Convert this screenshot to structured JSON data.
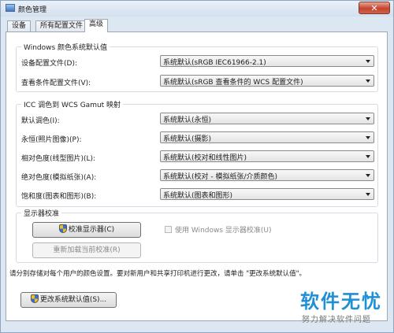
{
  "window": {
    "title": "颜色管理",
    "close_label": "✕"
  },
  "tabs": [
    {
      "label": "设备",
      "active": false
    },
    {
      "label": "所有配置文件",
      "active": false
    },
    {
      "label": "高级",
      "active": true
    }
  ],
  "windows_defaults": {
    "title": "Windows 颜色系统默认值",
    "rows": [
      {
        "label": "设备配置文件(D):",
        "value": "系统默认(sRGB IEC61966-2.1)"
      },
      {
        "label": "查看条件配置文件(V):",
        "value": "系统默认(sRGB 查看条件的 WCS 配置文件)"
      }
    ]
  },
  "icc_mapping": {
    "title": "ICC 调色到 WCS Gamut 映射",
    "rows": [
      {
        "label": "默认调色(I):",
        "value": "系统默认(永恒)"
      },
      {
        "label": "永恒(照片图像)(P):",
        "value": "系统默认(摄影)"
      },
      {
        "label": "相对色度(线型图片)(L):",
        "value": "系统默认(校对和线性图片)"
      },
      {
        "label": "绝对色度(模拟纸张)(A):",
        "value": "系统默认(校对 - 模拟纸张/介质颜色)"
      },
      {
        "label": "饱和度(图表和图形)(B):",
        "value": "系统默认(图表和图形)"
      }
    ]
  },
  "display_calibration": {
    "title": "显示器校准",
    "calibrate_button": "校准显示器(C)",
    "reload_button": "重新加载当前校准(R)",
    "use_windows_calibration": "使用 Windows 显示器校准(U)",
    "use_windows_calibration_checked": false
  },
  "note": "请分别存储对每个用户的颜色设置。要对新用户和共享打印机进行更改，请单击 \"更改系统默认值\"。",
  "change_defaults_button": "更改系统默认值(S)...",
  "watermark": {
    "title": "软件无忧",
    "subtitle": "努力解决软件问题"
  },
  "icons": {
    "title": "color-management-icon",
    "shield": "uac-shield-icon",
    "dropdown": "chevron-down-icon"
  }
}
